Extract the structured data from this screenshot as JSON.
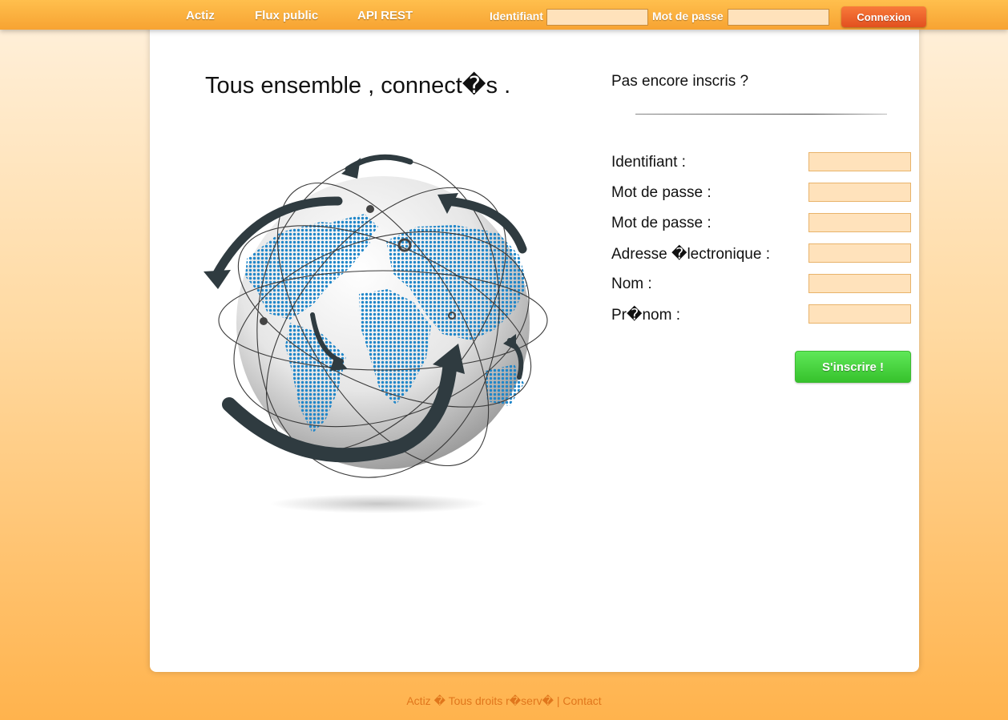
{
  "nav": {
    "links": [
      "Actiz",
      "Flux public",
      "API REST"
    ],
    "login": {
      "username_label": "Identifiant",
      "password_label": "Mot de passe",
      "button": "Connexion"
    }
  },
  "hero": {
    "title": "Tous ensemble , connect�s ."
  },
  "signup": {
    "title": "Pas encore inscris ?",
    "fields": [
      "Identifiant :",
      "Mot de passe :",
      "Mot de passe :",
      "Adresse �lectronique :",
      "Nom :",
      "Pr�nom :"
    ],
    "button": "S'inscrire !"
  },
  "footer": {
    "copyright": "Actiz � Tous droits r�serv�",
    "separator": "|",
    "contact": "Contact"
  },
  "colors": {
    "topbar": "#f7a332",
    "login_button": "#e2501f",
    "signup_button": "#36c22c",
    "input_background": "#ffe2bb",
    "footer_text": "#e0761c",
    "globe_dots": "#1f86c9"
  }
}
